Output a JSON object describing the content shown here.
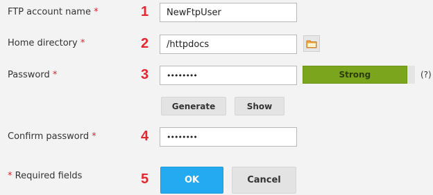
{
  "fields": [
    {
      "label": "FTP account name",
      "required_mark": "*",
      "step": "1",
      "value": "NewFtpUser"
    },
    {
      "label": "Home directory",
      "required_mark": "*",
      "step": "2",
      "value": "/httpdocs"
    },
    {
      "label": "Password",
      "required_mark": "*",
      "step": "3",
      "value": "••••••••"
    },
    {
      "label": "Confirm password",
      "required_mark": "*",
      "step": "4",
      "value": "••••••••"
    }
  ],
  "password_strength": {
    "label": "Strong",
    "level": 0.93,
    "color": "#7aa51c",
    "help": "(?)"
  },
  "buttons": {
    "generate": "Generate",
    "show": "Show",
    "ok": "OK",
    "cancel": "Cancel"
  },
  "footer": {
    "required_mark": "*",
    "required_note": "Required fields",
    "step": "5"
  },
  "icons": {
    "browse": "folder-icon"
  },
  "colors": {
    "required": "#d9272e",
    "step_number": "#e8242f",
    "ok_button": "#24aaf0"
  }
}
